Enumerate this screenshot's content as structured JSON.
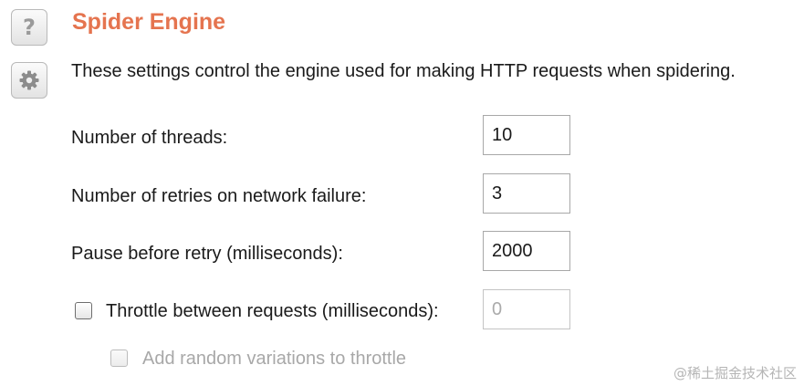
{
  "icons": {
    "help": "help-icon",
    "settings": "gear-icon"
  },
  "section": {
    "title": "Spider Engine",
    "title_color": "#e5744f",
    "description": "These settings control the engine used for making HTTP requests when spidering."
  },
  "settings": {
    "threads": {
      "label": "Number of threads:",
      "value": "10"
    },
    "retries": {
      "label": "Number of retries on network failure:",
      "value": "3"
    },
    "pause": {
      "label": "Pause before retry (milliseconds):",
      "value": "2000"
    },
    "throttle": {
      "label": "Throttle between requests (milliseconds):",
      "checked": false,
      "value": "0",
      "enabled": false
    },
    "random_variations": {
      "label": "Add random variations to throttle",
      "checked": false,
      "enabled": false
    }
  },
  "watermark": "@稀土掘金技术社区"
}
